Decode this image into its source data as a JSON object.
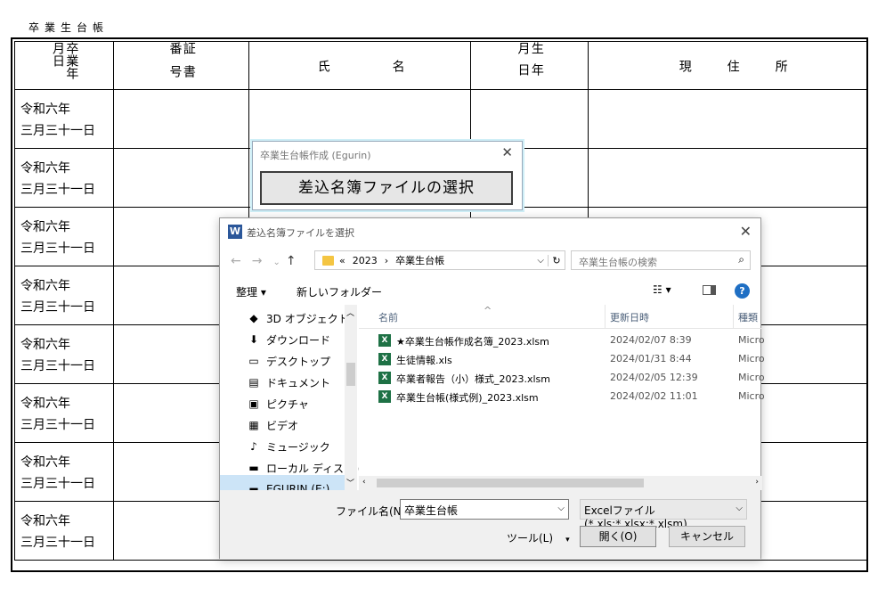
{
  "document": {
    "title": "卒業生台帳",
    "headers": {
      "grad_date": "卒業年月日",
      "cert_no": "証書番号",
      "name_1": "氏",
      "name_2": "名",
      "birth": "生年月日",
      "address_1": "現",
      "address_2": "住",
      "address_3": "所"
    },
    "rows": [
      {
        "line1": "令和六年",
        "line2": "三月三十一日"
      },
      {
        "line1": "令和六年",
        "line2": "三月三十一日"
      },
      {
        "line1": "令和六年",
        "line2": "三月三十一日"
      },
      {
        "line1": "令和六年",
        "line2": "三月三十一日"
      },
      {
        "line1": "令和六年",
        "line2": "三月三十一日"
      },
      {
        "line1": "令和六年",
        "line2": "三月三十一日"
      },
      {
        "line1": "令和六年",
        "line2": "三月三十一日"
      },
      {
        "line1": "令和六年",
        "line2": "三月三十一日"
      }
    ]
  },
  "small_dialog": {
    "title": "卒業生台帳作成 (Egurin)",
    "close": "✕",
    "select_button": "差込名簿ファイルの選択"
  },
  "file_dialog": {
    "app_icon": "W",
    "title": "差込名簿ファイルを選択",
    "close": "✕",
    "nav": {
      "back": "←",
      "forward": "→",
      "recent": "⌄",
      "up": "↑"
    },
    "breadcrumb": [
      "«",
      "2023",
      "›",
      "卒業生台帳"
    ],
    "refresh": "↻",
    "search_placeholder": "卒業生台帳の検索",
    "search_icon": "⌕",
    "toolbar": {
      "organize": "整理 ▾",
      "new_folder": "新しいフォルダー",
      "view": "☷ ▾",
      "help": "?"
    },
    "nav_items": [
      {
        "label": "3D オブジェクト",
        "icon": "cube-icon",
        "glyph": "◆"
      },
      {
        "label": "ダウンロード",
        "icon": "download-icon",
        "glyph": "⬇"
      },
      {
        "label": "デスクトップ",
        "icon": "desktop-icon",
        "glyph": "▭"
      },
      {
        "label": "ドキュメント",
        "icon": "document-icon",
        "glyph": "▤"
      },
      {
        "label": "ピクチャ",
        "icon": "picture-icon",
        "glyph": "▣"
      },
      {
        "label": "ビデオ",
        "icon": "video-icon",
        "glyph": "▦"
      },
      {
        "label": "ミュージック",
        "icon": "music-icon",
        "glyph": "♪"
      },
      {
        "label": "ローカル ディスク (C",
        "icon": "disk-icon",
        "glyph": "▬"
      },
      {
        "label": "EGURIN (E:)",
        "icon": "drive-icon",
        "glyph": "▬"
      }
    ],
    "columns": {
      "name": "名前",
      "modified": "更新日時",
      "type": "種類",
      "sort": "^"
    },
    "files": [
      {
        "name": "★卒業生台帳作成名簿_2023.xlsm",
        "modified": "2024/02/07 8:39",
        "type": "Micro"
      },
      {
        "name": "生徒情報.xls",
        "modified": "2024/01/31 8:44",
        "type": "Micro"
      },
      {
        "name": "卒業者報告（小）様式_2023.xlsm",
        "modified": "2024/02/05 12:39",
        "type": "Micro"
      },
      {
        "name": "卒業生台帳(様式例)_2023.xlsm",
        "modified": "2024/02/02 11:01",
        "type": "Micro"
      }
    ],
    "file_icon_glyph": "X",
    "filename_label": "ファイル名(N):",
    "filename_value": "卒業生台帳",
    "filetype": "Excelファイル (*.xls;*.xlsx;*.xlsm)",
    "tools": "ツール(L)",
    "open": "開く(O)",
    "cancel": "キャンセル",
    "dropdown": "⌵"
  }
}
